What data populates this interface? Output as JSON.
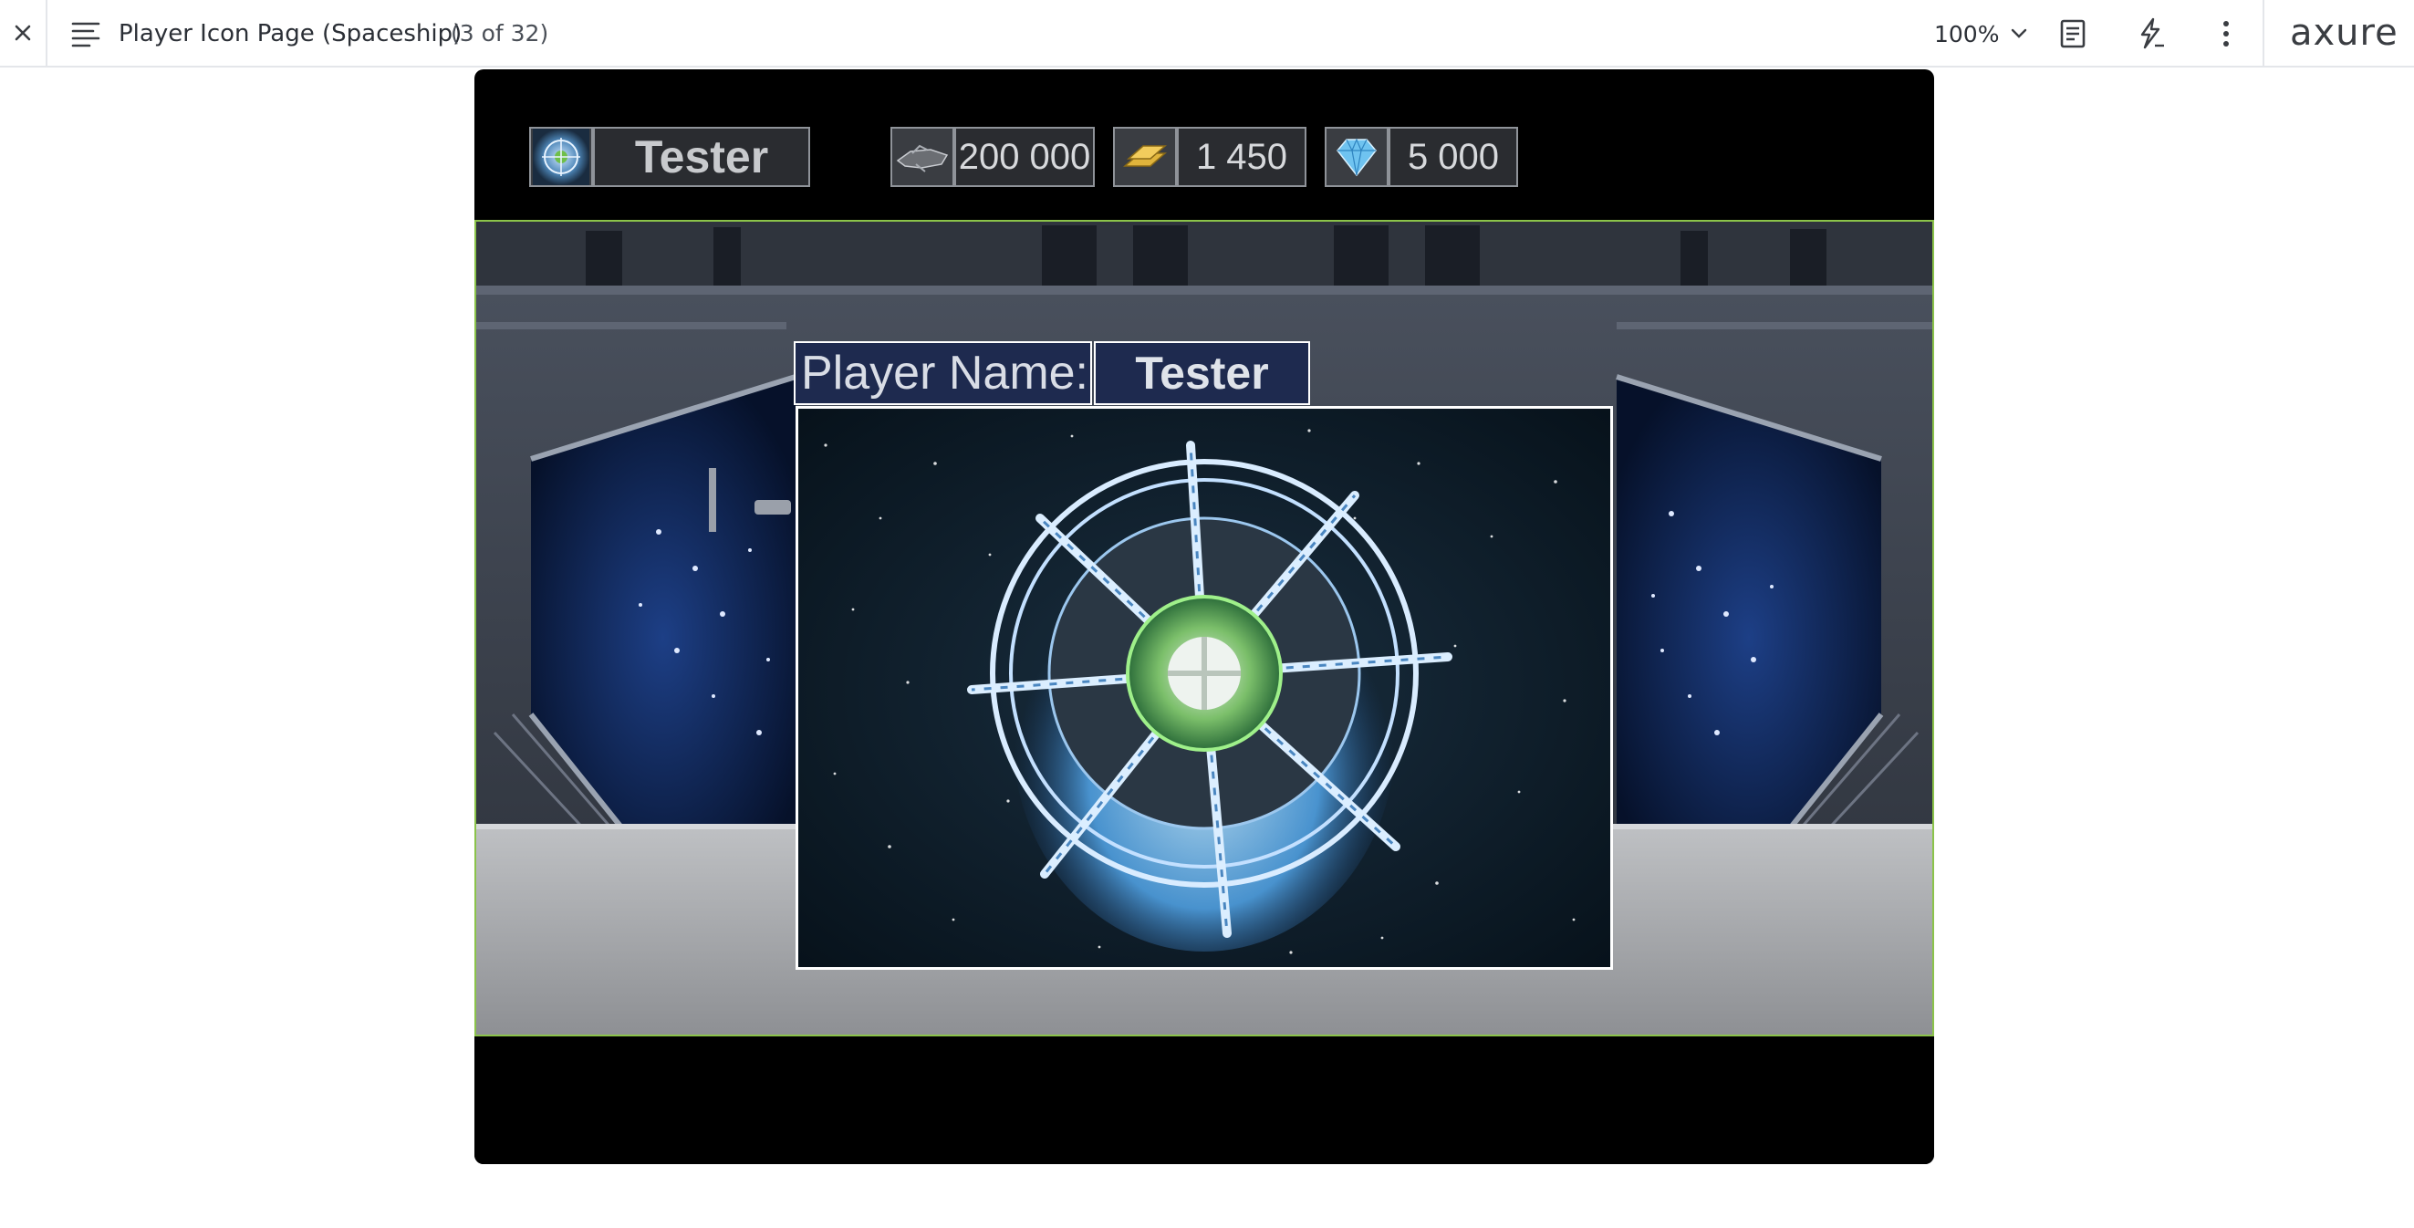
{
  "toolbar": {
    "page_title": "Player Icon Page (Spaceship)",
    "page_count": "(3 of 32)",
    "zoom": "100%",
    "logo": "axure",
    "icons": [
      "close-icon",
      "sitemap-menu-icon",
      "chevron-down-icon",
      "notes-icon",
      "interactions-icon",
      "more-icon"
    ]
  },
  "hud": {
    "player_name": "Tester",
    "ships": "200 000",
    "gold": "1 450",
    "gems": "5 000",
    "icons": [
      "player-avatar-icon",
      "spaceship-icon",
      "gold-bars-icon",
      "diamond-icon"
    ]
  },
  "profile": {
    "name_label": "Player Name:",
    "name_value": "Tester"
  },
  "colors": {
    "canvas_bg": "#000000",
    "scene_border": "#8bc34a",
    "name_box_bg": "#1e2a4f",
    "gold": "#e0b43c",
    "diamond": "#6fc3f0"
  }
}
